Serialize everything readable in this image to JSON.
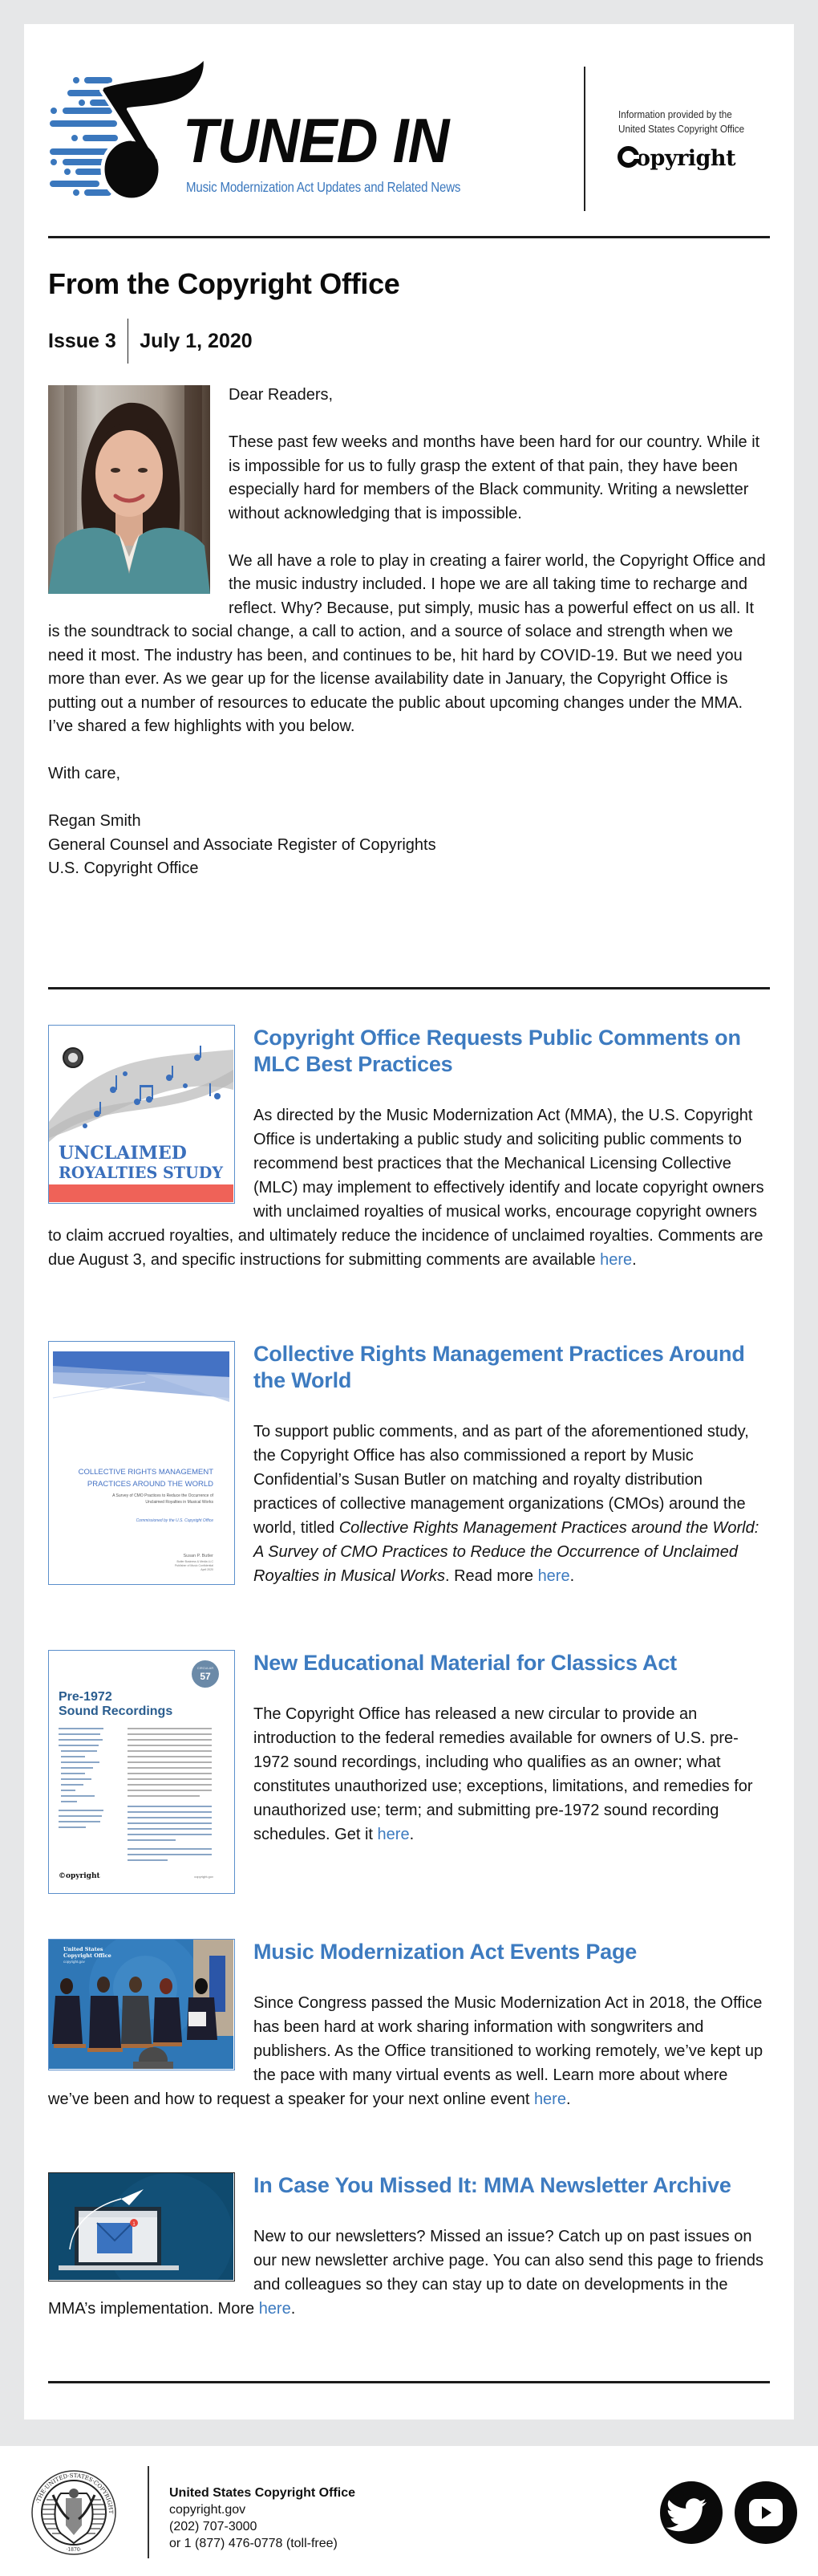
{
  "header": {
    "logo_title": "TUNED IN",
    "logo_subtitle": "Music Modernization Act Updates and Related News",
    "info_line1": "Information provided by the",
    "info_line2": "United States Copyright Office",
    "copyright_logo_text": "opyright"
  },
  "intro": {
    "page_title": "From the Copyright Office",
    "issue": "Issue 3",
    "date": "July 1, 2020"
  },
  "letter": {
    "greeting": "Dear Readers,",
    "paragraph1": "These past few weeks and months have been hard for our country. While it is impossible for us to fully grasp the extent of that pain, they have been especially hard for members of the Black community. Writing a newsletter without acknowledging that is impossible.",
    "paragraph2": "We all have a role to play in creating a fairer world, the Copyright Office and the music industry included. I hope we are all taking time to recharge and reflect. Why? Because, put simply, music has a powerful effect on us all. It is the soundtrack to social change, a call to action, and a source of solace and strength when we need it most. The industry has been, and continues to be, hit hard by COVID-19. But we need you more than ever. As we gear up for the license availability date in January, the Copyright Office is putting out a number of resources to educate the public about upcoming changes under the MMA. I’ve shared a few highlights with you below.",
    "closing": "With care,",
    "signer_name": "Regan Smith",
    "signer_title": "General Counsel and Associate Register of Copyrights",
    "signer_org": "U.S. Copyright Office"
  },
  "articles": [
    {
      "title": "Copyright Office Requests Public Comments on MLC Best Practices",
      "body": "As directed by the Music Modernization Act (MMA), the U.S. Copyright Office is undertaking a public study and soliciting public comments to recommend best practices that the Mechanical Licensing Collective (MLC) may implement to effectively identify and locate copyright owners with unclaimed royalties of musical works, encourage copyright owners to claim accrued royalties, and ultimately reduce the incidence of unclaimed royalties. Comments are due August 3, and specific instructions for submitting comments are available ",
      "link_text": "here",
      "after_link": ".",
      "image_text_line1": "UNCLAIMED",
      "image_text_line2": "ROYALTIES STUDY"
    },
    {
      "title": "Collective Rights Management Practices Around the World",
      "body": "To support public comments, and as part of the aforementioned study, the Copyright Office has also commissioned a report by Music Confidential’s Susan Butler on matching and royalty distribution practices of collective management organizations (CMOs) around the world, titled ",
      "italic_title": "Collective Rights Management Practices around the World: A Survey of CMO Practices to Reduce the Occurrence of Unclaimed Royalties in Musical Works",
      "before_link": ". Read more ",
      "link_text": "here",
      "after_link": ".",
      "image_heading_line1": "COLLECTIVE RIGHTS MANAGEMENT",
      "image_heading_line2": "PRACTICES AROUND THE WORLD",
      "image_subtitle_line1": "A Survey of CMO Practices to Reduce the Occurrence of",
      "image_subtitle_line2": "Unclaimed Royalties in Musical Works",
      "image_commissioned": "Commissioned by the U.S. Copyright Office",
      "image_author": "Susan P. Butler",
      "image_author_line2": "Butler Business & Media LLC",
      "image_author_line3": "Publisher of Music Confidential",
      "image_author_line4": "April 2020"
    },
    {
      "title": "New Educational Material for Classics Act",
      "body": "The Copyright Office has released a new circular to provide an introduction to the federal remedies available for owners of U.S. pre-1972 sound recordings, including who qualifies as an owner; what constitutes unauthorized use; exceptions, limitations, and remedies for unauthorized use; term; and submitting pre-1972 sound recording schedules. Get it ",
      "link_text": "here",
      "after_link": ".",
      "image_badge_label": "CIRCULAR",
      "image_badge_number": "57",
      "image_title_line1": "Pre-1972",
      "image_title_line2": "Sound Recordings",
      "image_footer_logo": "opyright",
      "image_footer_url": "copyright.gov"
    },
    {
      "title": "Music Modernization Act Events Page",
      "body": "Since Congress passed the Music Modernization Act in 2018, the Office has been hard at work sharing information with songwriters and publishers. As the Office transitioned to working remotely, we’ve kept up the pace with many virtual events as well. Learn more about where we’ve been and how to request a speaker for your next online event ",
      "link_text": "here",
      "after_link": ".",
      "image_banner_line1": "United States",
      "image_banner_line2": "Copyright Office",
      "image_banner_line3": "copyright.gov"
    },
    {
      "title": "In Case You Missed It: MMA Newsletter Archive",
      "body": "New to our newsletters? Missed an issue? Catch up on past issues on our new newsletter archive page. You can also send this page to friends and colleagues so they can stay up to date on developments in the MMA’s implementation. More ",
      "link_text": "here",
      "after_link": ".",
      "image_badge": "1"
    }
  ],
  "footer": {
    "org_name": "United States Copyright Office",
    "website": "copyright.gov",
    "phone": "(202) 707-3000",
    "toll_free": "or 1 (877) 476-0778 (toll-free)",
    "social": [
      {
        "name": "twitter-icon",
        "label": "Twitter"
      },
      {
        "name": "youtube-icon",
        "label": "YouTube"
      }
    ]
  },
  "colors": {
    "accent_blue": "#3d7bc0",
    "logo_blue": "#3a77bd",
    "page_background": "#e6e7e8",
    "unclaimed_red": "#ef6258"
  }
}
